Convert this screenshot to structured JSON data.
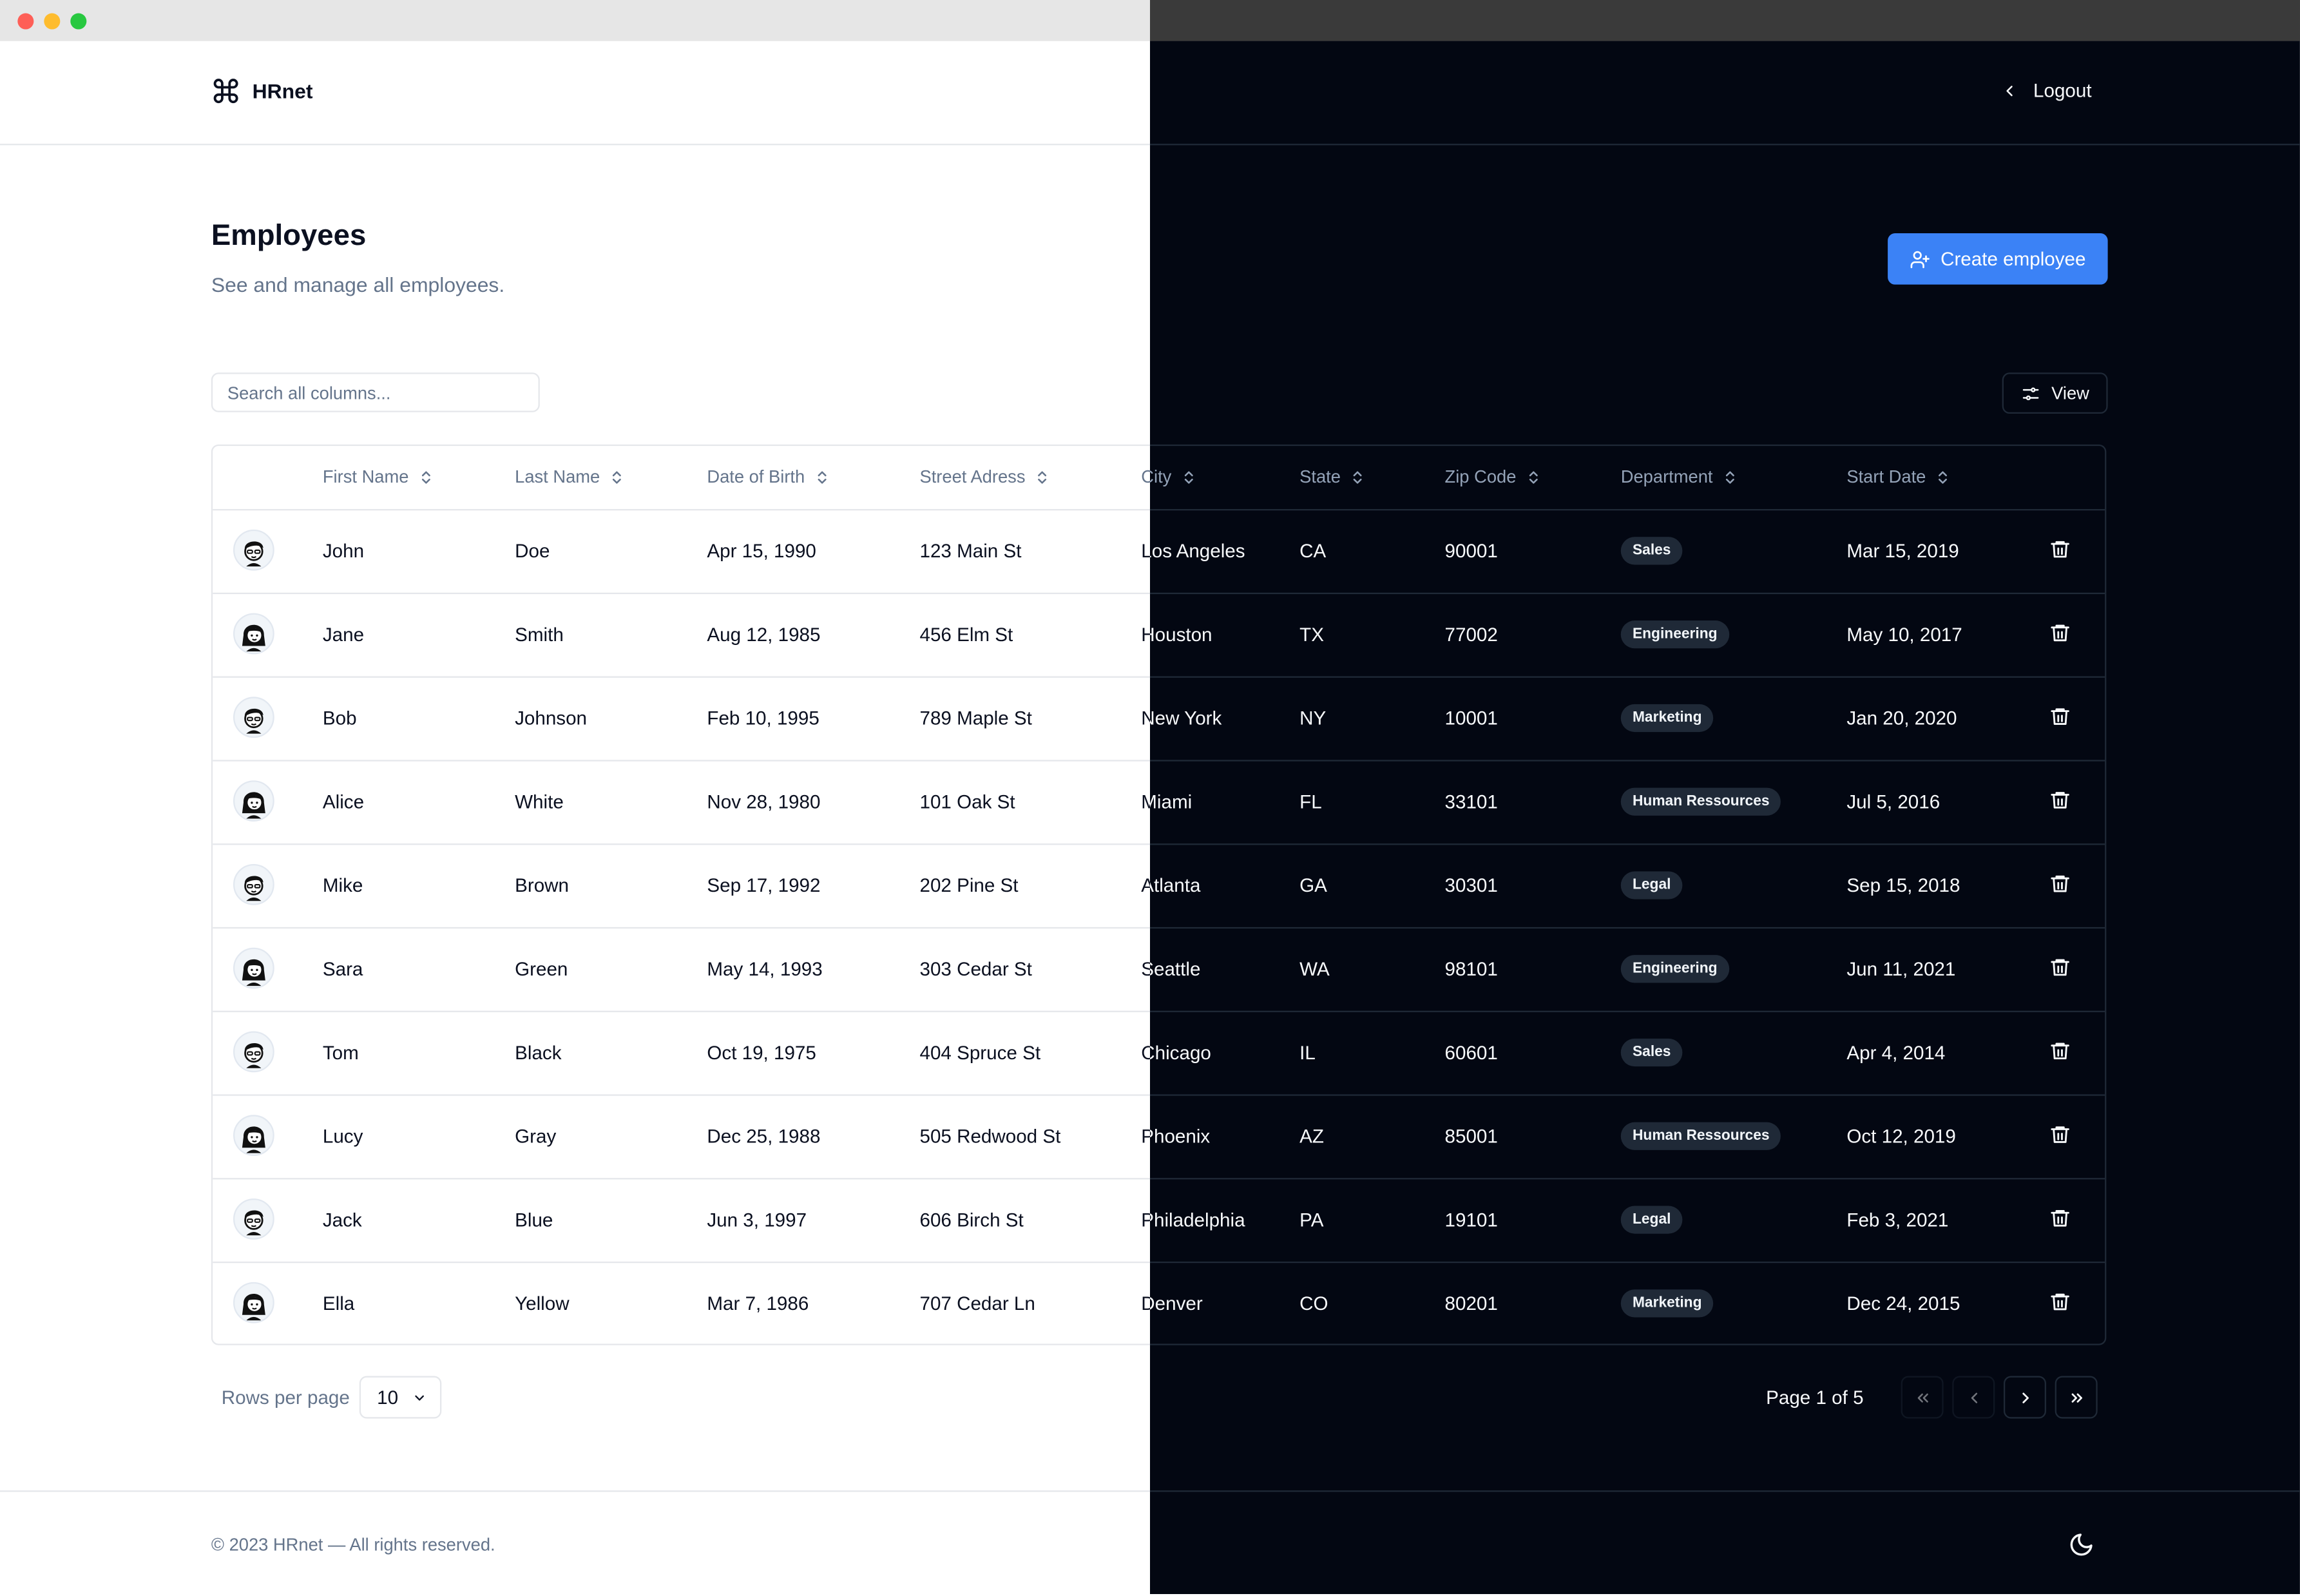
{
  "window": {
    "traffic_lights": [
      "close",
      "minimize",
      "zoom"
    ]
  },
  "header": {
    "brand": "HRnet",
    "brand_icon": "command-icon",
    "logout_label": "Logout"
  },
  "page": {
    "title": "Employees",
    "subtitle": "See and manage all employees.",
    "create_label": "Create employee",
    "search_placeholder": "Search all columns...",
    "view_label": "View"
  },
  "table": {
    "columns": [
      "First Name",
      "Last Name",
      "Date of Birth",
      "Street Adress",
      "City",
      "State",
      "Zip Code",
      "Department",
      "Start Date"
    ],
    "rows": [
      {
        "avatar": "male",
        "first": "John",
        "last": "Doe",
        "dob": "Apr 15, 1990",
        "street": "123 Main St",
        "city": "Los Angeles",
        "state": "CA",
        "zip": "90001",
        "dept": "Sales",
        "start": "Mar 15, 2019"
      },
      {
        "avatar": "female",
        "first": "Jane",
        "last": "Smith",
        "dob": "Aug 12, 1985",
        "street": "456 Elm St",
        "city": "Houston",
        "state": "TX",
        "zip": "77002",
        "dept": "Engineering",
        "start": "May 10, 2017"
      },
      {
        "avatar": "male",
        "first": "Bob",
        "last": "Johnson",
        "dob": "Feb 10, 1995",
        "street": "789 Maple St",
        "city": "New York",
        "state": "NY",
        "zip": "10001",
        "dept": "Marketing",
        "start": "Jan 20, 2020"
      },
      {
        "avatar": "female",
        "first": "Alice",
        "last": "White",
        "dob": "Nov 28, 1980",
        "street": "101 Oak St",
        "city": "Miami",
        "state": "FL",
        "zip": "33101",
        "dept": "Human Ressources",
        "start": "Jul 5, 2016"
      },
      {
        "avatar": "male",
        "first": "Mike",
        "last": "Brown",
        "dob": "Sep 17, 1992",
        "street": "202 Pine St",
        "city": "Atlanta",
        "state": "GA",
        "zip": "30301",
        "dept": "Legal",
        "start": "Sep 15, 2018"
      },
      {
        "avatar": "female",
        "first": "Sara",
        "last": "Green",
        "dob": "May 14, 1993",
        "street": "303 Cedar St",
        "city": "Seattle",
        "state": "WA",
        "zip": "98101",
        "dept": "Engineering",
        "start": "Jun 11, 2021"
      },
      {
        "avatar": "male",
        "first": "Tom",
        "last": "Black",
        "dob": "Oct 19, 1975",
        "street": "404 Spruce St",
        "city": "Chicago",
        "state": "IL",
        "zip": "60601",
        "dept": "Sales",
        "start": "Apr 4, 2014"
      },
      {
        "avatar": "female",
        "first": "Lucy",
        "last": "Gray",
        "dob": "Dec 25, 1988",
        "street": "505 Redwood St",
        "city": "Phoenix",
        "state": "AZ",
        "zip": "85001",
        "dept": "Human Ressources",
        "start": "Oct 12, 2019"
      },
      {
        "avatar": "male",
        "first": "Jack",
        "last": "Blue",
        "dob": "Jun 3, 1997",
        "street": "606 Birch St",
        "city": "Philadelphia",
        "state": "PA",
        "zip": "19101",
        "dept": "Legal",
        "start": "Feb 3, 2021"
      },
      {
        "avatar": "female",
        "first": "Ella",
        "last": "Yellow",
        "dob": "Mar 7, 1986",
        "street": "707 Cedar Ln",
        "city": "Denver",
        "state": "CO",
        "zip": "80201",
        "dept": "Marketing",
        "start": "Dec 24, 2015"
      }
    ]
  },
  "pagination": {
    "rows_per_page_label": "Rows per page",
    "rows_per_page_value": "10",
    "page_info": "Page 1 of 5"
  },
  "footer": {
    "copyright": "© 2023 HRnet — All rights reserved.",
    "theme_icon": "moon-icon"
  },
  "colors": {
    "primary": "#3b82f6",
    "light_bg": "#ffffff",
    "dark_bg": "#030712"
  }
}
